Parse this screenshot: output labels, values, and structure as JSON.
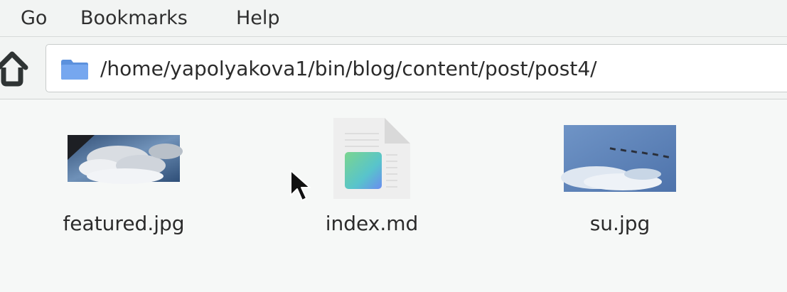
{
  "menubar": {
    "go": "Go",
    "bookmarks": "Bookmarks",
    "help": "Help"
  },
  "toolbar": {
    "home_icon": "home-icon",
    "location": {
      "icon": "folder-icon",
      "path": "/home/yapolyakova1/bin/blog/content/post/post4/"
    }
  },
  "files": [
    {
      "name": "featured.jpg",
      "type": "image",
      "icon": "image-thumbnail"
    },
    {
      "name": "index.md",
      "type": "markdown",
      "icon": "text-document-icon"
    },
    {
      "name": "su.jpg",
      "type": "image",
      "icon": "image-thumbnail"
    }
  ],
  "colors": {
    "background": "#f6f8f7",
    "folder_blue": "#6a9be2",
    "sky_blue": "#4f78b4",
    "document_gray": "#eeeeee"
  }
}
